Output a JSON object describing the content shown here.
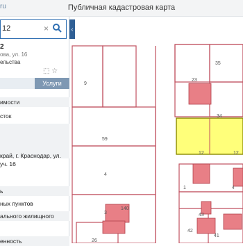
{
  "header": {
    "site_fragment": "ru",
    "title": "Публичная кадастровая карта"
  },
  "search": {
    "query": "12",
    "clear_glyph": "×"
  },
  "result": {
    "number": "2",
    "address": "ова, ул. 16",
    "category": "ельства"
  },
  "tabs": {
    "services_label": "Услуги"
  },
  "info_rows": [
    "имости",
    "сток",
    "край, г. Краснодар, ул.",
    "уч. 16",
    "ь",
    "ных пунктов",
    "ального жилищного",
    "",
    "енность"
  ],
  "map_labels": {
    "p9": "9",
    "p59": "59",
    "p4": "4",
    "p3": "3",
    "p26": "26",
    "p140": "140",
    "p23": "23",
    "p35": "35",
    "p34": "34",
    "p12a": "12",
    "p12b": "12",
    "p43": "43",
    "p42": "42",
    "p41": "41",
    "p1": "1",
    "p4b": "4"
  },
  "colors": {
    "selected_parcel": "#ffff7a",
    "parcel_border": "#c0505f",
    "building": "#e87f86",
    "panel_accent": "#2f6fb2"
  }
}
